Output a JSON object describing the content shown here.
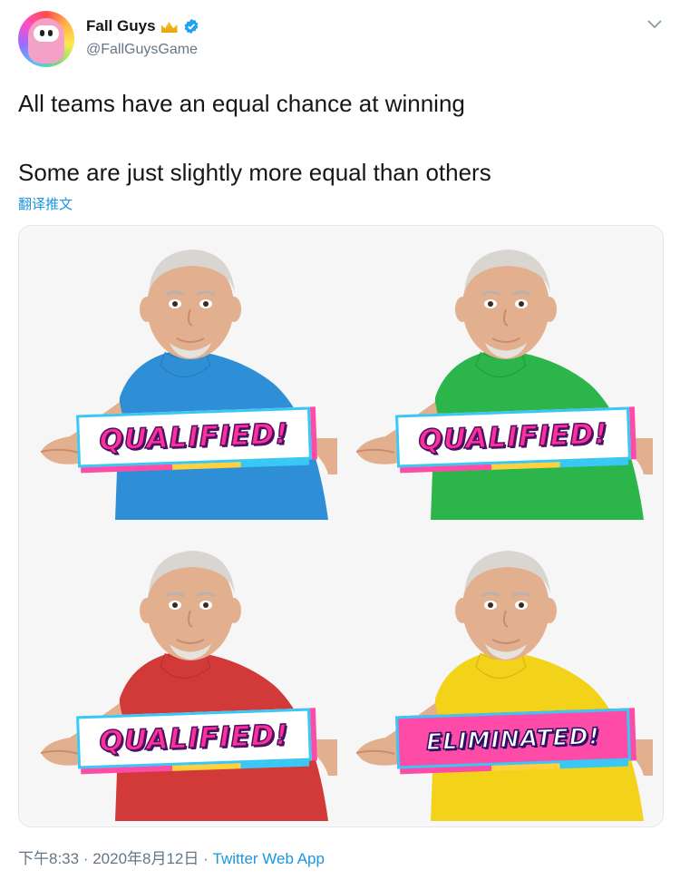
{
  "tweet": {
    "display_name": "Fall Guys",
    "handle": "@FallGuysGame",
    "text_line1": "All teams have an equal chance at winning",
    "text_line2": "Some are just slightly more equal than others",
    "translate_label": "翻译推文",
    "time": "下午8:33",
    "separator": " · ",
    "date": "2020年8月12日",
    "source": "Twitter Web App"
  },
  "icons": {
    "avatar": "fall-guys-bean-avatar",
    "crown": "crown-icon",
    "verified": "verified-badge-icon",
    "menu": "chevron-down-icon"
  },
  "colors": {
    "link": "#1b95e0",
    "muted": "#657786",
    "sweater_blue": "#2f8fd6",
    "sweater_green": "#2bb54a",
    "sweater_red": "#d23a3a",
    "sweater_yellow": "#f3d21a"
  },
  "media": {
    "panels": [
      {
        "sweater": "#2f8fd6",
        "banner": "QUALIFIED!",
        "eliminated": false
      },
      {
        "sweater": "#2bb54a",
        "banner": "QUALIFIED!",
        "eliminated": false
      },
      {
        "sweater": "#d23a3a",
        "banner": "QUALIFIED!",
        "eliminated": false
      },
      {
        "sweater": "#f3d21a",
        "banner": "ELIMINATED!",
        "eliminated": true
      }
    ]
  }
}
